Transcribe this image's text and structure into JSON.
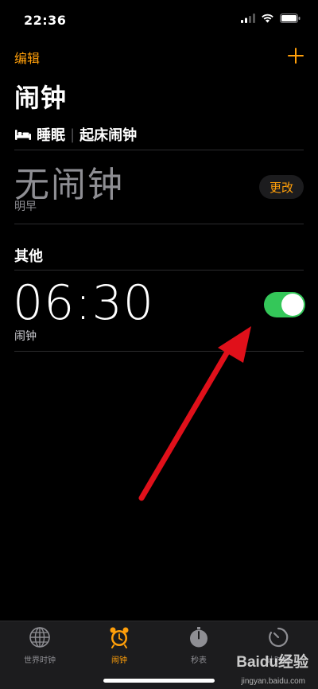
{
  "status_bar": {
    "time": "22:36"
  },
  "nav": {
    "edit_label": "编辑"
  },
  "page": {
    "title": "闹钟"
  },
  "sleep": {
    "title": "睡眠",
    "subtitle": "起床闹钟",
    "status": "无闹钟",
    "day": "明早",
    "change_label": "更改"
  },
  "other": {
    "title": "其他",
    "alarms": [
      {
        "time": "06:30",
        "label": "闹钟",
        "enabled": true
      }
    ]
  },
  "tabs": [
    {
      "label": "世界时钟",
      "icon": "globe-icon"
    },
    {
      "label": "闹钟",
      "icon": "alarm-clock-icon",
      "active": true
    },
    {
      "label": "秒表",
      "icon": "stopwatch-icon"
    },
    {
      "label": "计时器",
      "icon": "timer-icon"
    }
  ],
  "watermark": {
    "brand": "Baidu经验",
    "url": "jingyan.baidu.com"
  },
  "colors": {
    "accent": "#ff9f0a",
    "toggle_on": "#34c759",
    "arrow": "#e0101a"
  }
}
